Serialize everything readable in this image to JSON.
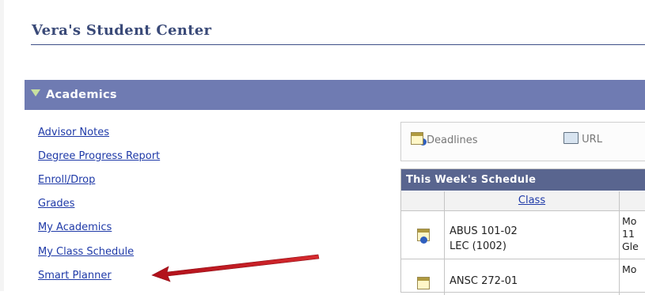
{
  "page": {
    "title": "Vera's Student Center"
  },
  "section": {
    "title": "Academics"
  },
  "links": [
    "Advisor Notes",
    "Degree Progress Report",
    "Enroll/Drop",
    "Grades",
    "My Academics",
    "My Class Schedule",
    "Smart Planner"
  ],
  "toolbar": {
    "deadlines": "Deadlines",
    "url": "URL"
  },
  "schedule": {
    "title": "This Week's Schedule",
    "column_class": "Class",
    "rows": [
      {
        "course": "ABUS 101-02",
        "section": "LEC (1002)",
        "time_lines": [
          "Mo",
          "11",
          "Gle"
        ]
      },
      {
        "course": "ANSC 272-01",
        "section": "",
        "time_lines": [
          "Mo"
        ]
      }
    ]
  },
  "colors": {
    "header": "#6f7bb2",
    "schedule_header": "#59658f",
    "link": "#1f3aa8",
    "arrow": "#c0141b"
  }
}
